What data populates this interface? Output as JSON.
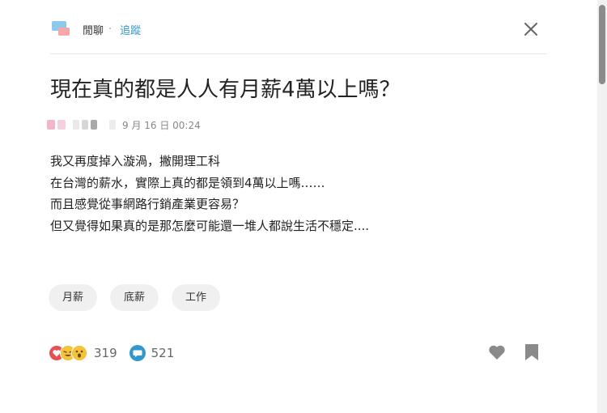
{
  "header": {
    "forum_name": "閒聊",
    "separator": "·",
    "follow_label": "追蹤"
  },
  "post": {
    "title": "現在真的都是人人有月薪4萬以上嗎？",
    "date": "9 月 16 日 00:24",
    "body_lines": [
      "我又再度掉入漩渦，撇開理工科",
      "在台灣的薪水，實際上真的都是領到4萬以上嗎……",
      "而且感覺從事網路行銷產業更容易？",
      "但又覺得如果真的是那怎麼可能還一堆人都說生活不穩定...."
    ],
    "tags": [
      "月薪",
      "底薪",
      "工作"
    ]
  },
  "footer": {
    "reaction_count": "319",
    "comment_count": "521",
    "reaction_icons": [
      "heart-reaction-icon",
      "laugh-reaction-icon",
      "wow-reaction-icon"
    ]
  },
  "colors": {
    "accent": "#3397cf",
    "heart": "#e8504f",
    "tag_bg": "#f0f0f0",
    "icon_gray": "#8a8a8a"
  }
}
